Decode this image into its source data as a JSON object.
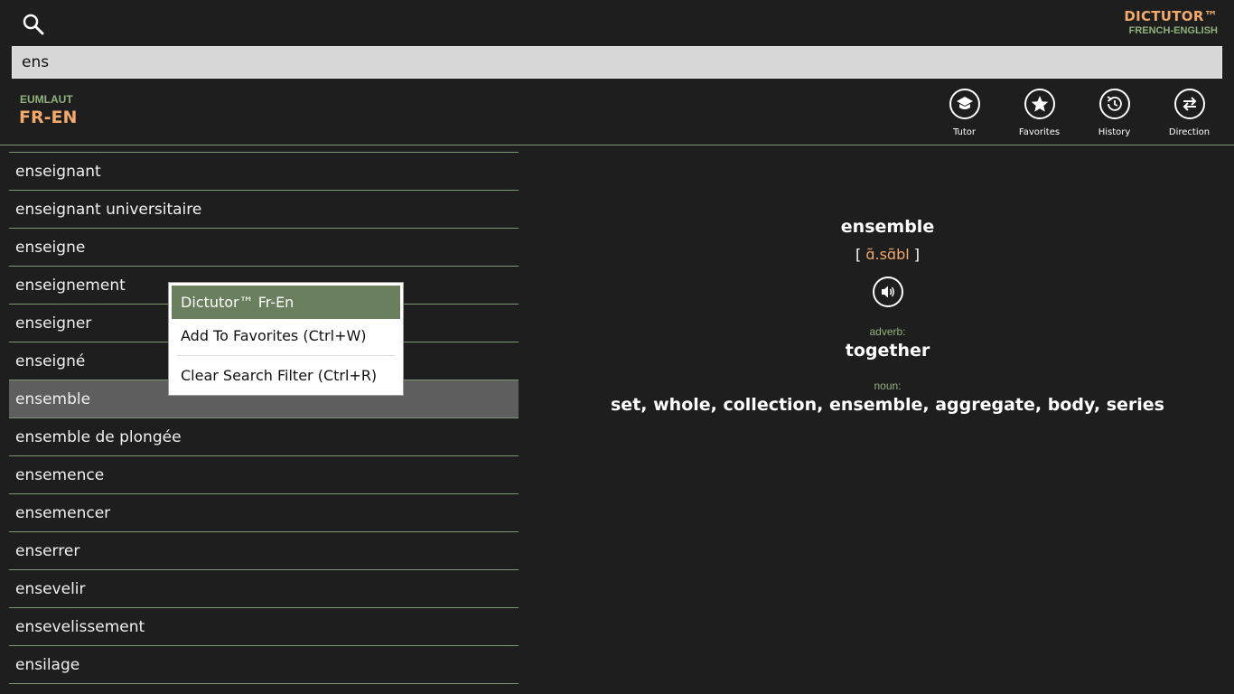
{
  "app": {
    "brand_name": "DICTUTOR™",
    "brand_sub": "FRENCH-ENGLISH"
  },
  "search": {
    "value": "ens",
    "icon": "search-icon"
  },
  "dictionary": {
    "label": "EUMLAUT",
    "direction": "FR-EN"
  },
  "toolbar": {
    "tutor_label": "Tutor",
    "favorites_label": "Favorites",
    "history_label": "History",
    "direction_label": "Direction"
  },
  "word_list": {
    "items": [
      "enseignant",
      "enseignant universitaire",
      "enseigne",
      "enseignement",
      "enseigner",
      "enseigné",
      "ensemble",
      "ensemble de plongée",
      "ensemence",
      "ensemencer",
      "enserrer",
      "ensevelir",
      "ensevelissement",
      "ensilage"
    ],
    "selected": "ensemble"
  },
  "definition": {
    "headword": "ensemble",
    "pron_open": "[ ",
    "pron_ipa": "ɑ̃.sɑ̃bl",
    "pron_close": " ]",
    "senses": [
      {
        "pos": "adverb:",
        "meaning": "together"
      },
      {
        "pos": "noun:",
        "meaning": "set, whole, collection, ensemble, aggregate, body, series"
      }
    ]
  },
  "context_menu": {
    "title": "Dictutor™ Fr-En",
    "add_favorites": "Add To Favorites (Ctrl+W)",
    "clear_filter": "Clear Search Filter (Ctrl+R)"
  },
  "colors": {
    "background": "#1e1e1e",
    "accent_orange": "#f2a96b",
    "accent_green": "#8fb27d",
    "selected_row": "#5e5e5e",
    "menu_active": "#6a7f5e"
  }
}
